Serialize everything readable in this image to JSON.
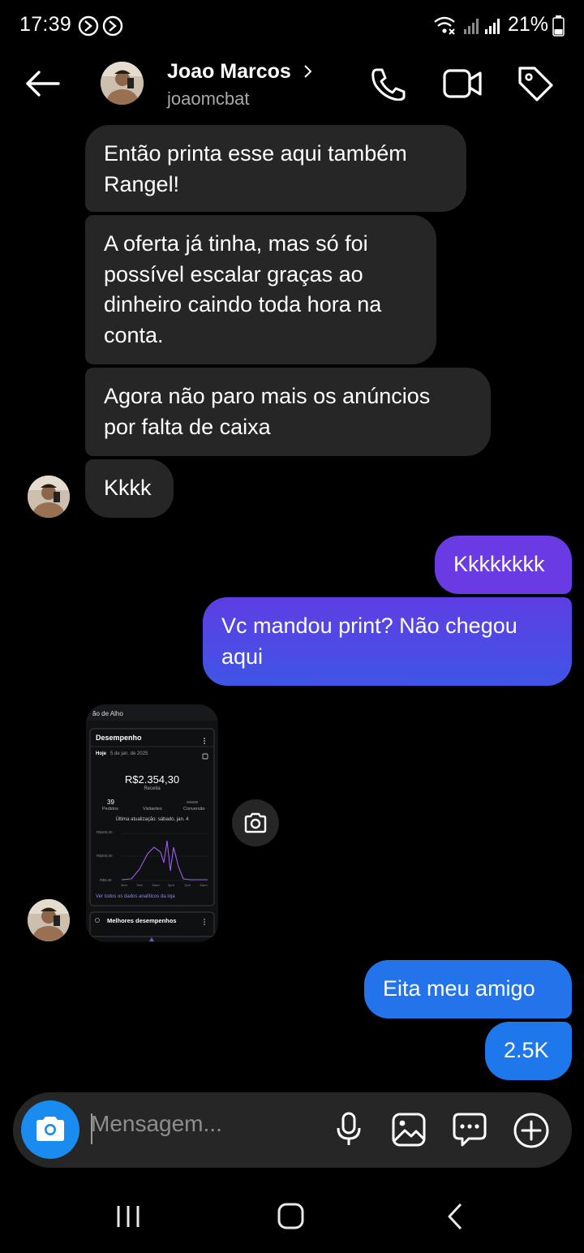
{
  "status_bar": {
    "time": "17:39",
    "battery_percent": "21%"
  },
  "header": {
    "name": "Joao Marcos",
    "username": "joaomcbat"
  },
  "messages": [
    {
      "side": "in",
      "text": "Então printa esse aqui também\nRangel!"
    },
    {
      "side": "in",
      "text": "A oferta já tinha, mas só foi\npossível escalar graças ao\ndinheiro caindo toda hora na\nconta."
    },
    {
      "side": "in",
      "text": "Agora não paro mais os anúncios\npor falta de caixa"
    },
    {
      "side": "in",
      "text": "Kkkk"
    },
    {
      "side": "out",
      "text": "Kkkkkkkk"
    },
    {
      "side": "out",
      "text": "Vc mandou print? Não chegou\naqui"
    },
    {
      "side": "out",
      "text": "Eita meu amigo"
    },
    {
      "side": "out",
      "text": "2.5K"
    }
  ],
  "shared_screenshot": {
    "store_name_partial": "ão de Alho",
    "card_title": "Desempenho",
    "date_label": "Hoje",
    "date_value": "5 de jan. de 2025",
    "revenue": "R$2.354,30",
    "revenue_label": "Receita",
    "orders_value": "39",
    "orders_label": "Pedidos",
    "visitors_label": "Visitantes",
    "conversion_label": "Conversão",
    "last_update": "Última atualização: sábado, jan. 4",
    "y_ticks": [
      "R$400,00",
      "R$200,00",
      "R$0,00"
    ],
    "x_ticks": [
      "3am",
      "7am",
      "11am",
      "3pm",
      "7pm",
      "11pm"
    ],
    "view_all_link": "Ver todos os dados analíticos da loja",
    "best_section": "Melhores desempenhos"
  },
  "composer": {
    "placeholder": "Mensagem..."
  },
  "colors": {
    "incoming_bubble": "#262626",
    "outgoing_gradient_top": "#6a3fe6",
    "outgoing_gradient_bottom": "#2f6ae8",
    "outgoing_blue": "#1e74ea",
    "camera_button": "#1a8cf0",
    "chart_line": "#9b5cf0"
  }
}
